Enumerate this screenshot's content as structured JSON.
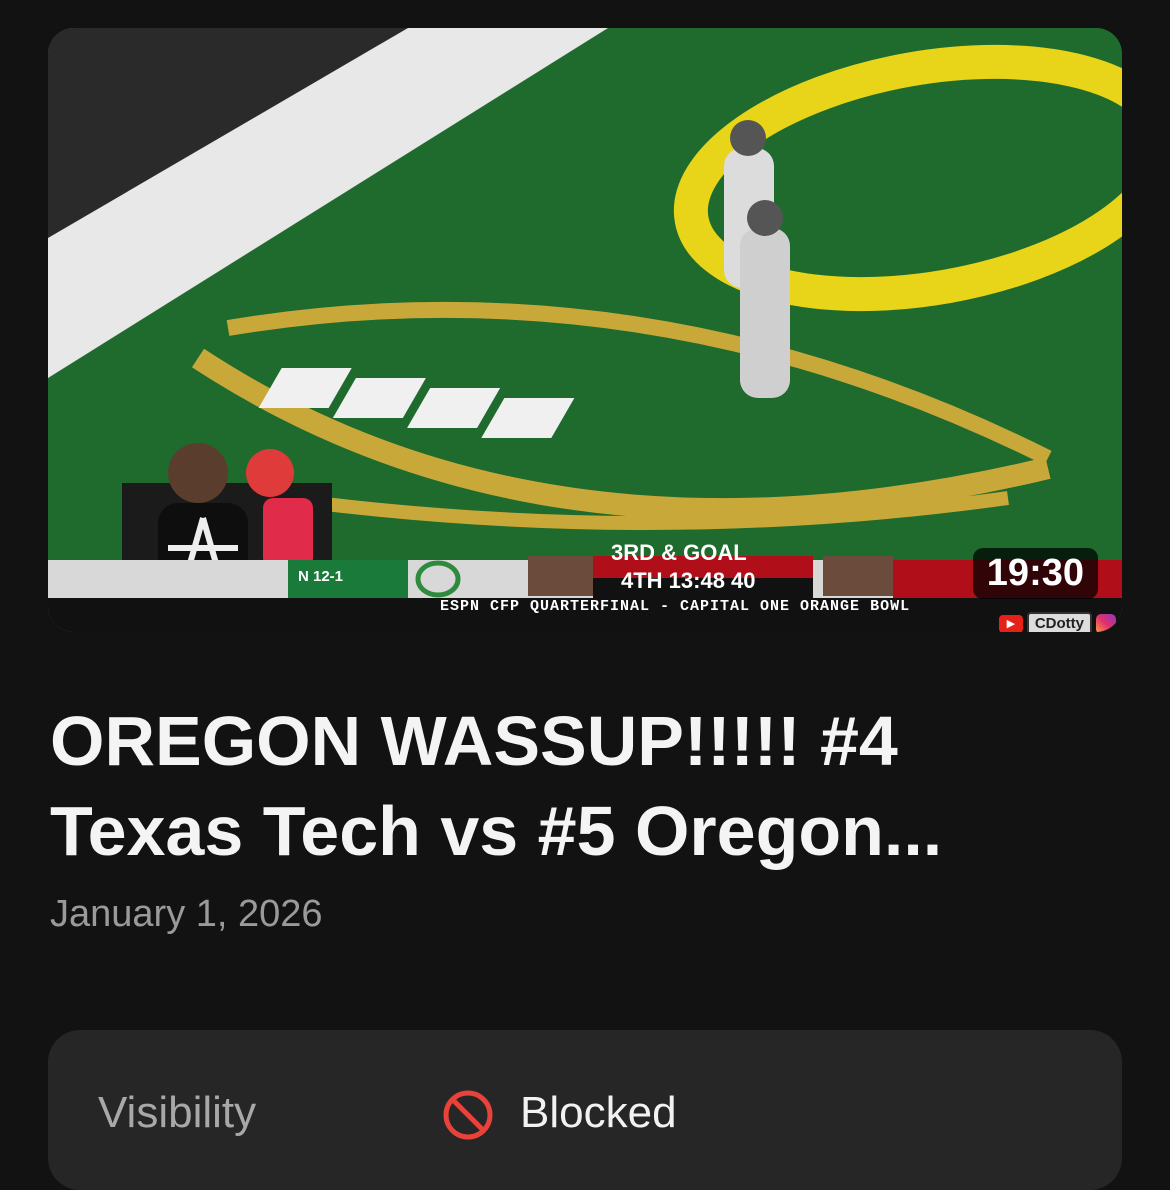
{
  "video": {
    "duration": "19:30",
    "overlay": {
      "down_distance": "3RD & GOAL",
      "quarter_clock": "4TH 13:48 40",
      "broadcast_line": "ESPN CFP QUARTERFINAL - CAPITAL ONE ORANGE BOWL",
      "team_record": "N 12-1",
      "channel": "CDotty"
    },
    "title": "OREGON WASSUP!!!!! #4 Texas Tech vs #5 Oregon...",
    "date": "January 1, 2026"
  },
  "details": {
    "visibility_label": "Visibility",
    "visibility_value": "Blocked",
    "visibility_icon": "blocked-icon"
  },
  "colors": {
    "background": "#121212",
    "card": "#262626",
    "blocked_red": "#e8423a"
  }
}
